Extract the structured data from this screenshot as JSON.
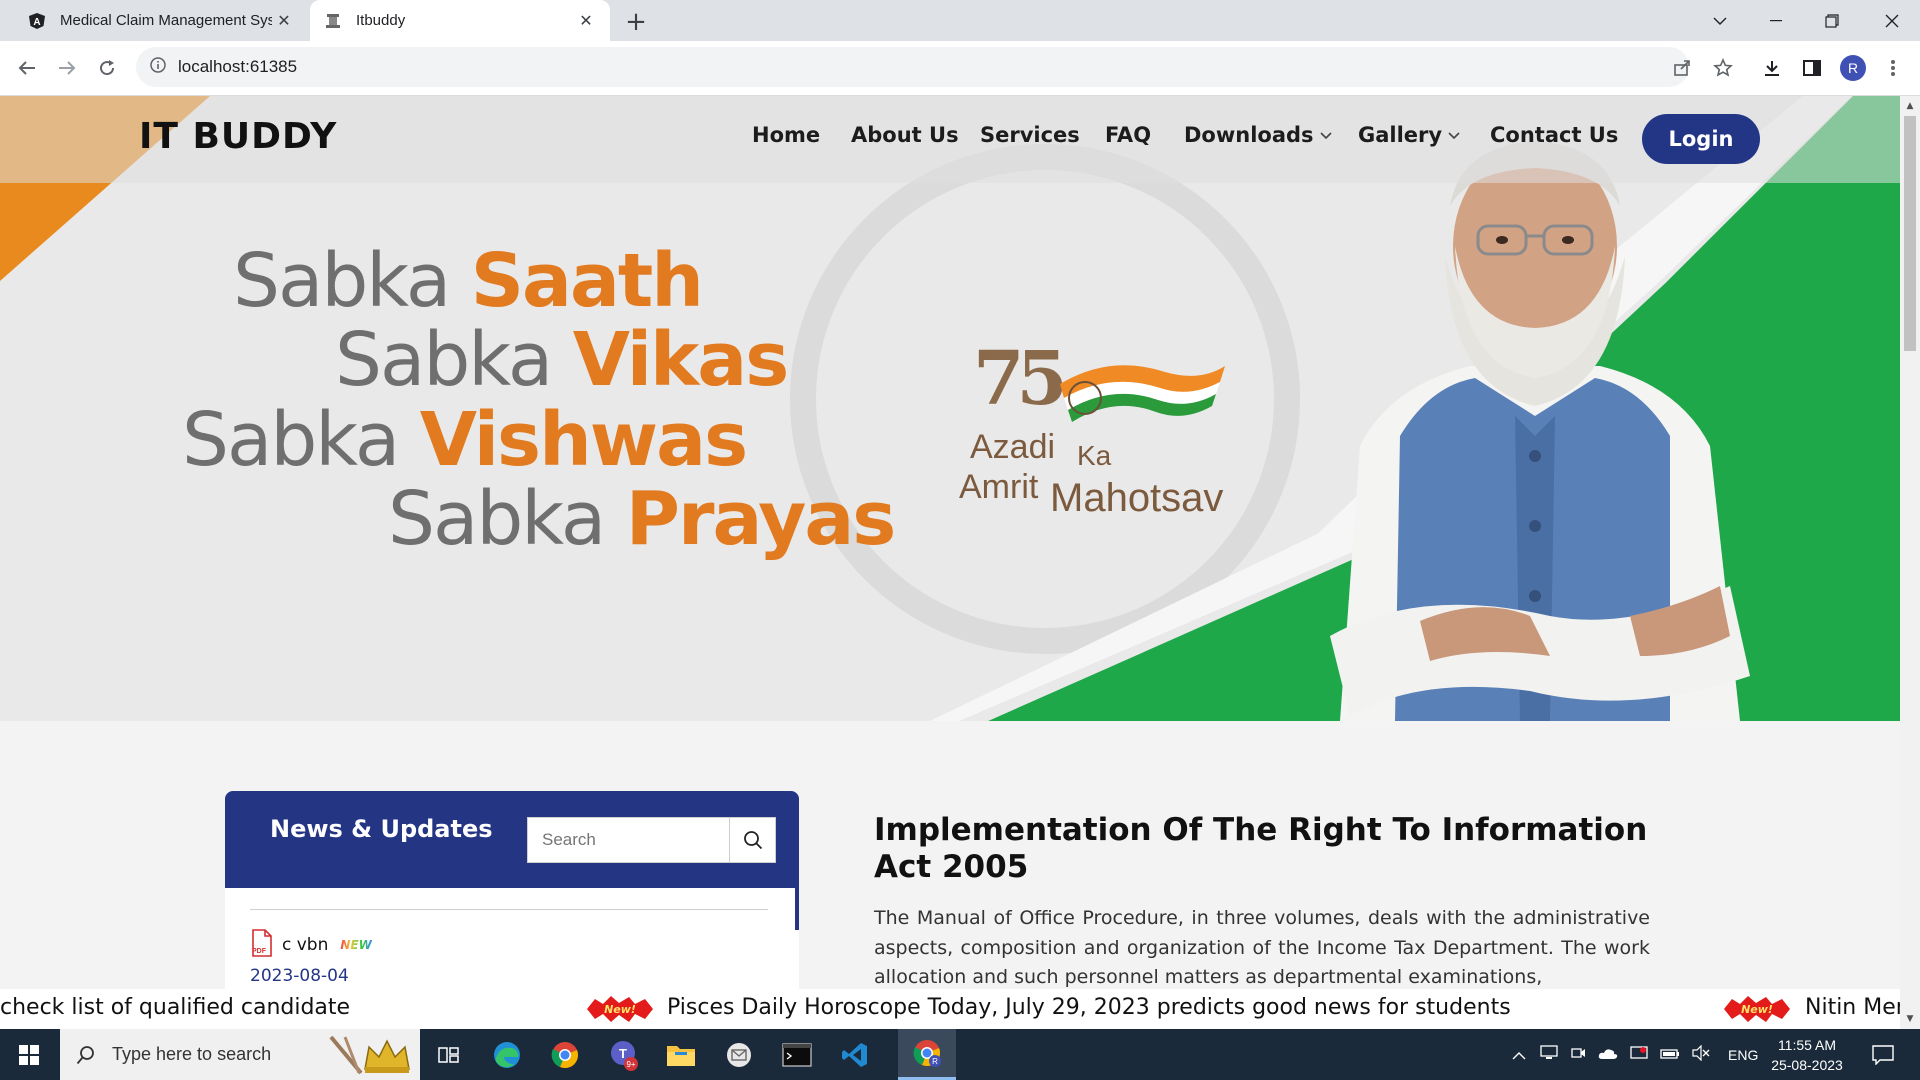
{
  "browser": {
    "tabs": [
      {
        "title": "Medical Claim Management Syst",
        "active": false,
        "icon": "angular-icon"
      },
      {
        "title": "Itbuddy",
        "active": true,
        "icon": "emblem-icon"
      }
    ],
    "url": "localhost:61385",
    "profile_initial": "R"
  },
  "site": {
    "brand": "IT BUDDY",
    "nav": [
      {
        "label": "Home",
        "dropdown": false
      },
      {
        "label": "About Us",
        "dropdown": false
      },
      {
        "label": "Services",
        "dropdown": false
      },
      {
        "label": "FAQ",
        "dropdown": false
      },
      {
        "label": "Downloads",
        "dropdown": true
      },
      {
        "label": "Gallery",
        "dropdown": true
      },
      {
        "label": "Contact Us",
        "dropdown": false
      }
    ],
    "login_label": "Login"
  },
  "hero": {
    "lines": [
      {
        "gray": "Sabka ",
        "orange": "Saath"
      },
      {
        "gray": "Sabka ",
        "orange": "Vikas"
      },
      {
        "gray": "Sabka ",
        "orange": "Vishwas"
      },
      {
        "gray": "Sabka ",
        "orange": "Prayas"
      }
    ],
    "azadi": {
      "number": "75",
      "w1": "Azadi",
      "w2": "Ka",
      "w3": "Amrit",
      "w4": "Mahotsav"
    }
  },
  "news": {
    "title": "News & Updates",
    "search_placeholder": "Search",
    "items": [
      {
        "text": "c vbn",
        "badge": "NEW",
        "date": "2023-08-04"
      }
    ]
  },
  "article": {
    "title": "Implementation Of The Right To Information Act 2005",
    "body": "The Manual of Office Procedure, in three volumes, deals with the administrative aspects, composition and organization of the Income Tax Department. The work allocation and such personnel matters as departmental examinations,"
  },
  "ticker": {
    "items": [
      "check list of qualified candidate",
      "Pisces Daily Horoscope Today, July 29, 2023 predicts good news for students",
      "Nitin Mer"
    ],
    "badge": "New!"
  },
  "taskbar": {
    "search_placeholder": "Type here to search",
    "language": "ENG",
    "time": "11:55 AM",
    "date": "25-08-2023"
  },
  "colors": {
    "navy": "#243584",
    "orange": "#e27a20",
    "green": "#1fa84a"
  }
}
